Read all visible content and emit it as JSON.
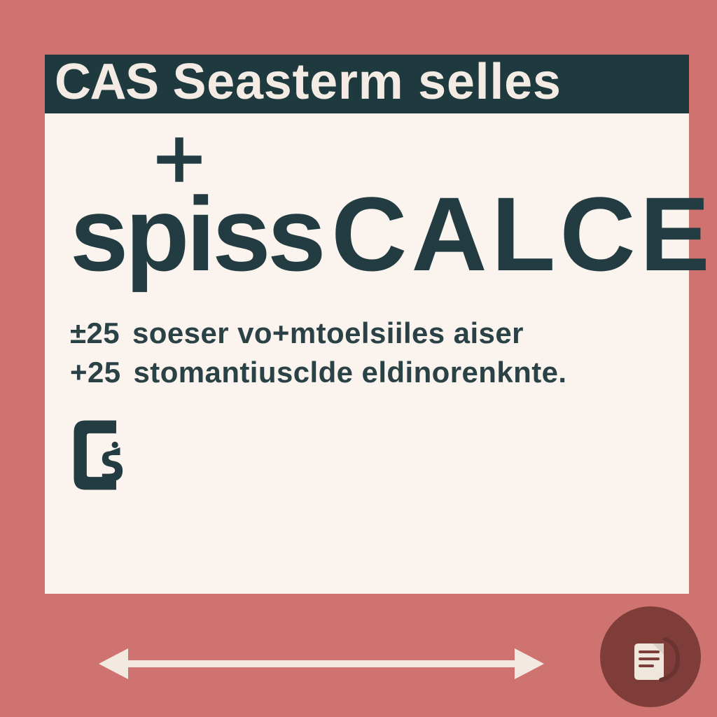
{
  "colors": {
    "bg": "#cf7371",
    "panel": "#fbf4ee",
    "ink": "#1f3a3f",
    "badge": "#7f3d3a",
    "arrow": "#f2e9e0"
  },
  "header": {
    "lead": "CAS",
    "rest": "Seasterm selles"
  },
  "hero": {
    "left": "spiss",
    "right": "CALCEI"
  },
  "lines": [
    {
      "code": "±25",
      "text": "soeser vo+mtoelsiiles aiser"
    },
    {
      "code": "+25",
      "text": "stomantiusclde eldinorenknte."
    }
  ],
  "mark": "Cs",
  "icons": {
    "plus": "plus-icon",
    "badge": "clipboard-icon",
    "arrow": "double-arrow-icon"
  }
}
